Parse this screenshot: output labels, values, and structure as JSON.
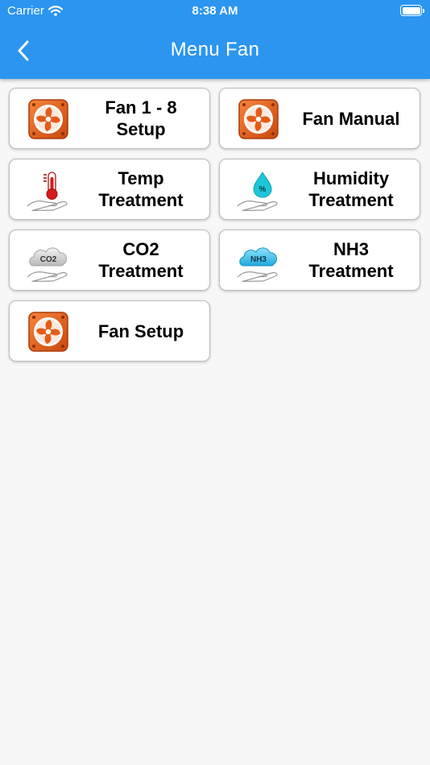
{
  "status_bar": {
    "carrier": "Carrier",
    "time": "8:38 AM"
  },
  "header": {
    "title": "Menu Fan",
    "back_icon": "chevron-left-icon"
  },
  "colors": {
    "app_bar": "#2b95f0",
    "fan_icon": "#e8621c",
    "water_drop": "#1cc6d8",
    "thermometer": "#d71a1a",
    "cloud_nh3": "#3cc3ec"
  },
  "menu": {
    "items": [
      {
        "label": "Fan 1 - 8\nSetup",
        "icon": "fan-icon"
      },
      {
        "label": "Fan Manual",
        "icon": "fan-icon"
      },
      {
        "label": "Temp\nTreatment",
        "icon": "temperature-hand-icon"
      },
      {
        "label": "Humidity\nTreatment",
        "icon": "humidity-hand-icon"
      },
      {
        "label": "CO2\nTreatment",
        "icon": "co2-cloud-hand-icon",
        "icon_text": "CO2"
      },
      {
        "label": "NH3\nTreatment",
        "icon": "nh3-cloud-hand-icon",
        "icon_text": "NH3"
      },
      {
        "label": "Fan Setup",
        "icon": "fan-icon"
      }
    ]
  }
}
